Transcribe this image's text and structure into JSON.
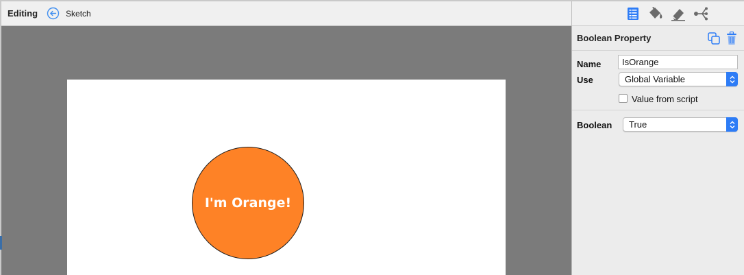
{
  "editor": {
    "mode_label": "Editing",
    "breadcrumb": "Sketch",
    "canvas": {
      "circle": {
        "label": "I'm Orange!",
        "fill": "#fe8226"
      }
    }
  },
  "inspector": {
    "toolbar": {
      "icons": [
        "properties-icon",
        "paint-bucket-icon",
        "eraser-icon",
        "connections-icon"
      ]
    },
    "section_title": "Boolean Property",
    "name_label": "Name",
    "name_value": "IsOrange",
    "use_label": "Use",
    "use_value": "Global Variable",
    "value_from_script_label": "Value from script",
    "value_from_script_checked": false,
    "boolean_label": "Boolean",
    "boolean_value": "True"
  },
  "colors": {
    "accent": "#2d7cf6",
    "canvas_bg": "#7b7b7b",
    "orange": "#fe8226"
  }
}
